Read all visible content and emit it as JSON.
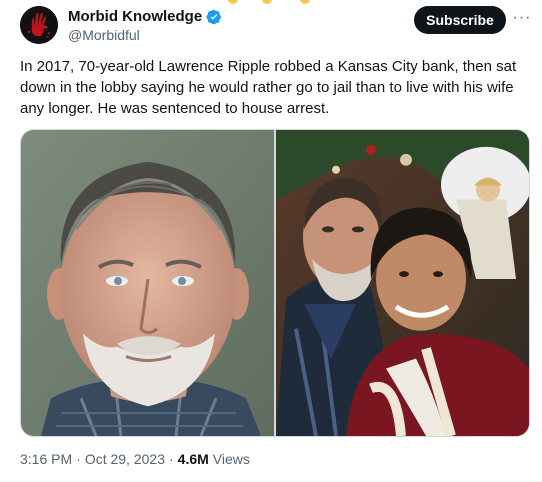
{
  "author": {
    "name": "Morbid Knowledge",
    "handle": "@Morbidful",
    "avatar_icon": "red-handprint-icon",
    "verified_icon": "verified-badge-icon",
    "verified_color": "#1d9bf0"
  },
  "actions": {
    "subscribe_label": "Subscribe",
    "more_label": "···"
  },
  "tweet": {
    "text": "In 2017, 70-year-old Lawrence Ripple robbed a Kansas City bank, then sat down in the lobby saying he would rather go to jail than to live with his wife any longer. He was sentenced to house arrest."
  },
  "media": {
    "photos": [
      "mugshot-photo",
      "couple-photo"
    ]
  },
  "meta": {
    "time": "3:16 PM",
    "separator": "·",
    "date": "Oct 29, 2023",
    "views_count": "4.6M",
    "views_label": "Views"
  },
  "colors": {
    "text_primary": "#0f1419",
    "text_secondary": "#536471",
    "button_dark": "#0f1419"
  }
}
